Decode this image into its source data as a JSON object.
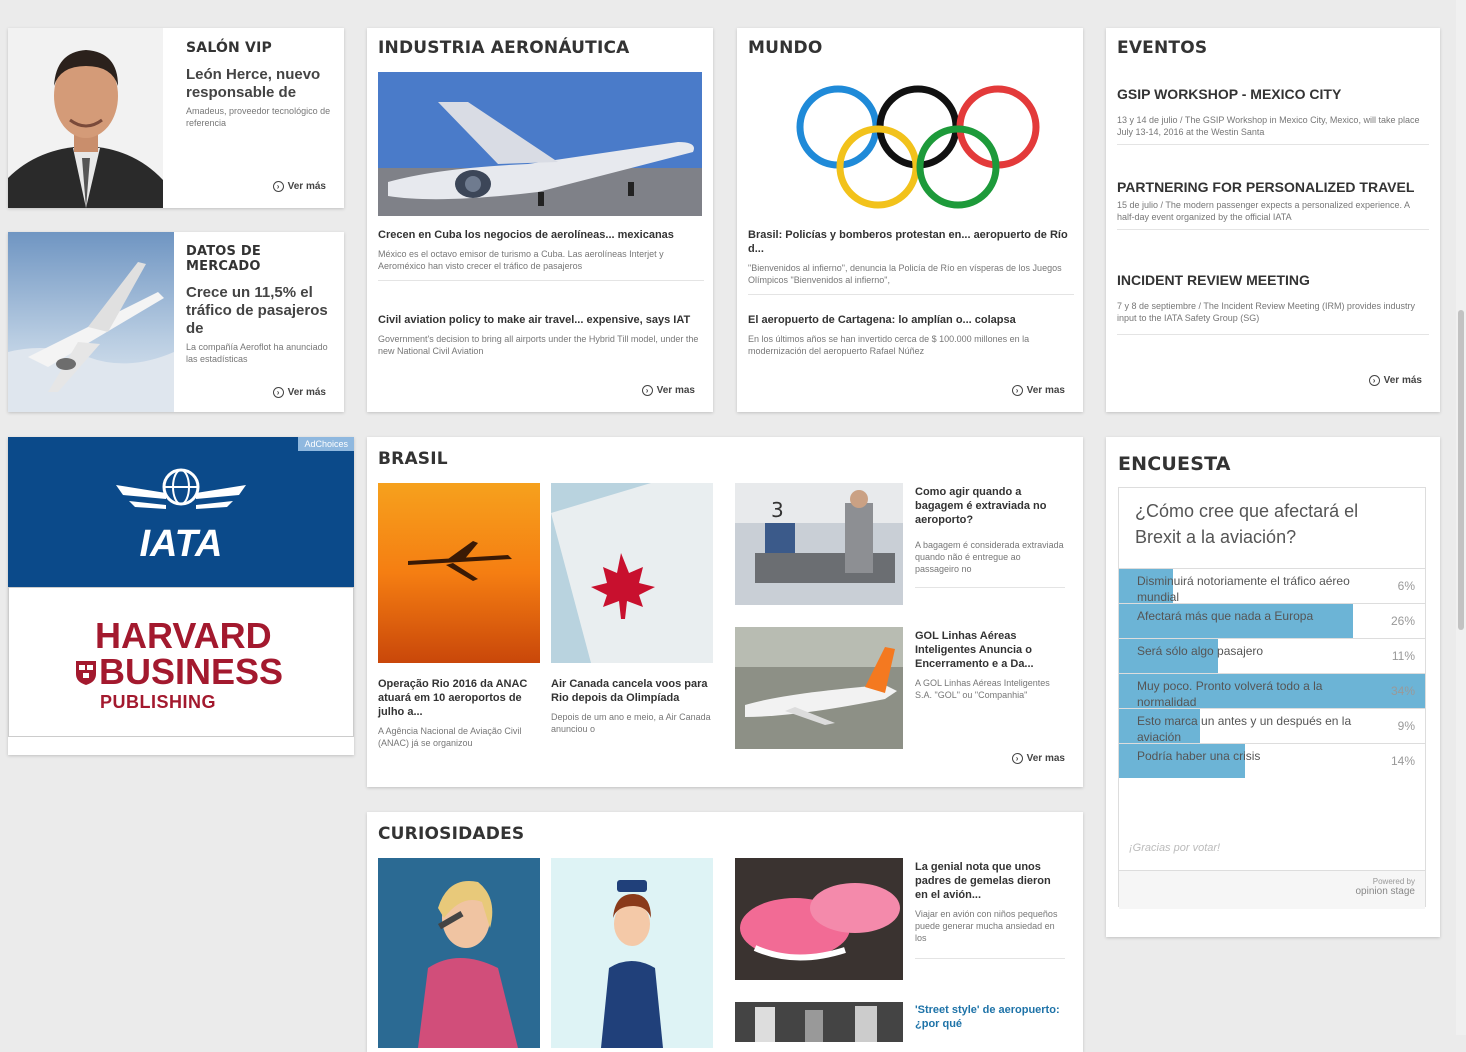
{
  "salon_vip": {
    "title": "SALÓN VIP",
    "headline": "León Herce, nuevo responsable de",
    "excerpt": "Amadeus, proveedor tecnológico de referencia",
    "more": "Ver más"
  },
  "datos_mercado": {
    "title": "DATOS DE MERCADO",
    "headline": "Crece un 11,5% el tráfico de pasajeros de",
    "excerpt": "La compañía Aeroflot ha anunciado las estadísticas",
    "more": "Ver más"
  },
  "ad": {
    "iata": "IATA",
    "harvard1": "HARVARD",
    "harvard2": "BUSINESS",
    "harvard3": "PUBLISHING",
    "badge": "AdChoices"
  },
  "industria": {
    "title": "INDUSTRIA AERONÁUTICA",
    "items": [
      {
        "headline": "Crecen en Cuba los negocios de aerolíneas... mexicanas",
        "excerpt": "México es el octavo emisor de turismo a Cuba. Las aerolíneas Interjet y Aeroméxico han visto crecer el tráfico de pasajeros"
      },
      {
        "headline": "Civil aviation policy to make air travel... expensive, says IAT",
        "excerpt": "Government's decision to bring all airports under the Hybrid Till model, under the new National Civil Aviation"
      }
    ],
    "more": "Ver mas"
  },
  "mundo": {
    "title": "MUNDO",
    "items": [
      {
        "headline": "Brasil: Policías y bomberos protestan en... aeropuerto de Río d...",
        "excerpt": "\"Bienvenidos al infierno\", denuncia la Policía de Río en vísperas de los Juegos Olímpicos \"Bienvenidos al infierno\","
      },
      {
        "headline": "El aeropuerto de Cartagena: lo amplían o... colapsa",
        "excerpt": "En los últimos años se han invertido cerca de $ 100.000 millones en la modernización del aeropuerto Rafael Núñez"
      }
    ],
    "more": "Ver mas"
  },
  "eventos": {
    "title": "EVENTOS",
    "items": [
      {
        "headline": "GSIP WORKSHOP - MEXICO CITY",
        "excerpt": "13 y 14 de julio / The GSIP Workshop in Mexico City, Mexico, will take place July 13-14, 2016 at the Westin Santa"
      },
      {
        "headline": "PARTNERING FOR PERSONALIZED TRAVEL",
        "excerpt": "15 de julio / The modern passenger expects a personalized experience. A half-day event organized by the official IATA"
      },
      {
        "headline": "INCIDENT REVIEW MEETING",
        "excerpt": "7 y 8 de septiembre / The Incident Review Meeting (IRM) provides industry input to the IATA Safety Group (SG)"
      }
    ],
    "more": "Ver más"
  },
  "brasil": {
    "title": "BRASIL",
    "col1": {
      "headline": "Operação Rio 2016 da ANAC atuará em 10 aeroportos de julho a...",
      "excerpt": "A Agência Nacional de Aviação Civil (ANAC) já se organizou"
    },
    "col2": {
      "headline": "Air Canada cancela voos para Rio depois da Olimpíada",
      "excerpt": "Depois de um ano e meio, a Air Canada anunciou o"
    },
    "list": [
      {
        "headline": "Como agir quando a bagagem é extraviada no aeroporto?",
        "excerpt": "A bagagem é considerada extraviada quando não é entregue ao passageiro no"
      },
      {
        "headline": "GOL Linhas Aéreas Inteligentes Anuncia o Encerramento e a Da...",
        "excerpt": "A GOL Linhas Aéreas Inteligentes S.A. \"GOL\" ou \"Companhia\""
      }
    ],
    "more": "Ver mas"
  },
  "curiosidades": {
    "title": "CURIOSIDADES",
    "list": [
      {
        "headline": "La genial nota que unos padres de gemelas dieron en el avión...",
        "excerpt": "Viajar en avión con niños pequeños puede generar mucha ansiedad en los"
      },
      {
        "headline": "'Street style' de aeropuerto: ¿por qué"
      }
    ]
  },
  "encuesta": {
    "title": "ENCUESTA",
    "question": "¿Cómo cree que afectará el Brexit a la aviación?",
    "options": [
      {
        "label": "Disminuirá notoriamente el tráfico aéreo mundial",
        "pct": "6%",
        "value": 6
      },
      {
        "label": "Afectará más que nada a Europa",
        "pct": "26%",
        "value": 26
      },
      {
        "label": "Será sólo algo pasajero",
        "pct": "11%",
        "value": 11
      },
      {
        "label": "Muy poco. Pronto volverá todo a la normalidad",
        "pct": "34%",
        "value": 34
      },
      {
        "label": "Esto marca un antes y un después en la aviación",
        "pct": "9%",
        "value": 9
      },
      {
        "label": "Podría haber una crisis",
        "pct": "14%",
        "value": 14
      }
    ],
    "thanks": "¡Gracias por votar!",
    "powered1": "Powered by",
    "powered2": "opinion stage"
  },
  "colors": {
    "poll_fill": "#6cb4d6",
    "iata_blue": "#0b4a8a",
    "harvard_red": "#a3192e"
  }
}
